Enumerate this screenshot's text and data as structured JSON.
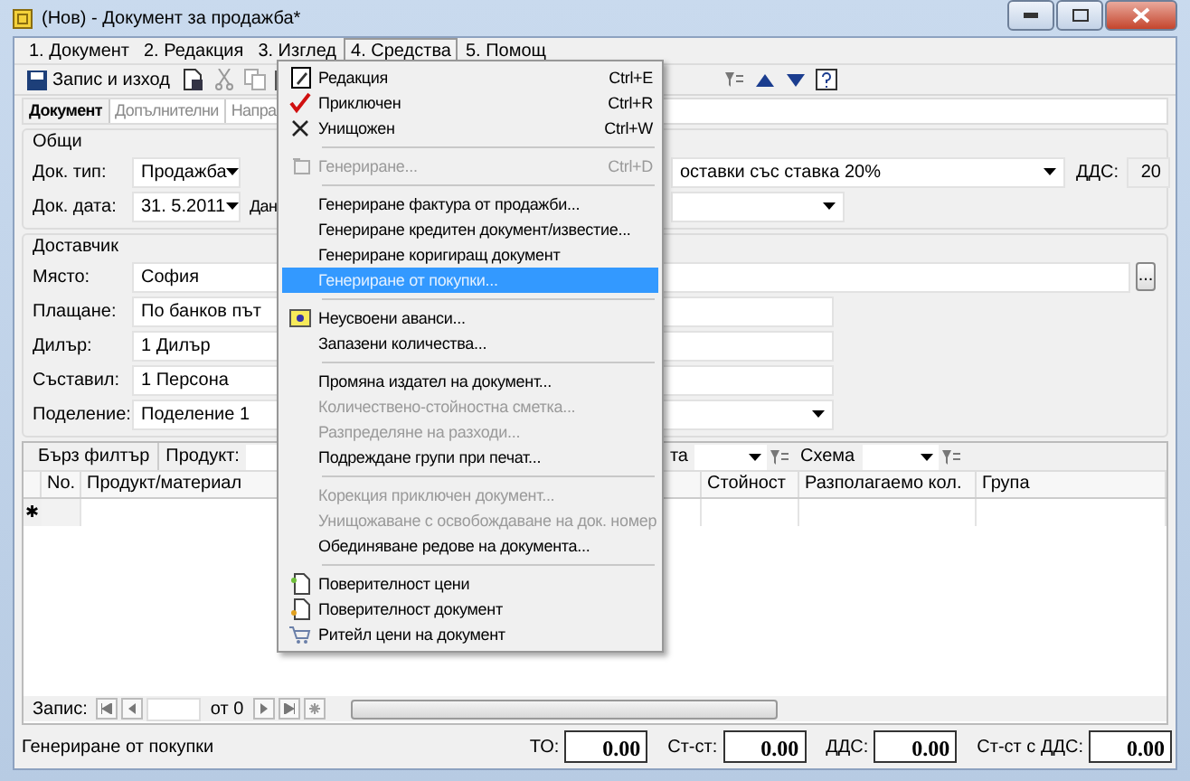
{
  "window": {
    "title": "(Нов) - Документ за продажба*"
  },
  "menu_bar": [
    {
      "label": "1. Документ",
      "selected": false
    },
    {
      "label": "2. Редакция",
      "selected": false
    },
    {
      "label": "3. Изглед",
      "selected": false
    },
    {
      "label": "4. Средства",
      "selected": true
    },
    {
      "label": "5. Помощ",
      "selected": false
    }
  ],
  "toolbar": {
    "save_label": "Запис и изход"
  },
  "tabs": [
    {
      "label": "Документ",
      "selected": true
    },
    {
      "label": "Допълнителни",
      "selected": false
    },
    {
      "label": "Напра",
      "selected": false
    }
  ],
  "general": {
    "title": "Общи",
    "doc_type_label": "Док. тип:",
    "doc_type": "Продажба",
    "doc_date_label": "Док. дата:",
    "doc_date": "31. 5.2011",
    "cut_label": "Дан",
    "vat_scheme": "оставки със ставка 20%",
    "vat_label": "ДДС:",
    "vat": "20"
  },
  "supplier": {
    "title": "Доставчик",
    "fields": [
      {
        "label": "Място:",
        "value": "София",
        "kind": "wide",
        "button": "..."
      },
      {
        "label": "Плащане:",
        "value": "По банков път",
        "kind": "text"
      },
      {
        "label": "Дилър:",
        "value": "1 Дилър",
        "kind": "text"
      },
      {
        "label": "Съставил:",
        "value": "1 Персона",
        "kind": "text"
      },
      {
        "label": "Поделение:",
        "value": "Поделение 1",
        "kind": "combo"
      }
    ]
  },
  "grid": {
    "quick_filter": "Бърз филтър",
    "product_label": "Продукт:",
    "cut_label": "та",
    "scheme_label": "Схема",
    "columns": [
      "No.",
      "Продукт/материал",
      "Стойност",
      "Разполагаемо кол.",
      "Група"
    ],
    "new_row_marker": "✱"
  },
  "navigator": {
    "label": "Запис:",
    "count": "от 0"
  },
  "status_bar": {
    "message": "Генериране от покупки",
    "totals": [
      {
        "label": "ТО:",
        "value": "0.00"
      },
      {
        "label": "Ст-ст:",
        "value": "0.00"
      },
      {
        "label": "ДДС:",
        "value": "0.00"
      },
      {
        "label": "Ст-ст с ДДС:",
        "value": "0.00"
      }
    ]
  },
  "menu": {
    "sections": [
      [
        {
          "label": "Редакция",
          "shortcut": "Ctrl+E",
          "disabled": false,
          "selected": false
        },
        {
          "label": "Приключен",
          "shortcut": "Ctrl+R",
          "disabled": false,
          "selected": false
        },
        {
          "label": "Унищожен",
          "shortcut": "Ctrl+W",
          "disabled": false,
          "selected": false
        }
      ],
      [
        {
          "label": "Генериране...",
          "shortcut": "Ctrl+D",
          "disabled": true,
          "selected": false
        }
      ],
      [
        {
          "label": "Генериране фактура от продажби...",
          "disabled": false,
          "selected": false
        },
        {
          "label": "Генериране кредитен документ/известие...",
          "disabled": false,
          "selected": false
        },
        {
          "label": "Генериране коригиращ документ",
          "disabled": false,
          "selected": false
        },
        {
          "label": "Генериране от покупки...",
          "disabled": false,
          "selected": true
        }
      ],
      [
        {
          "label": "Неусвоени аванси...",
          "disabled": false,
          "selected": false
        },
        {
          "label": "Запазени количества...",
          "disabled": false,
          "selected": false
        }
      ],
      [
        {
          "label": "Промяна издател на документ...",
          "disabled": false,
          "selected": false
        },
        {
          "label": "Количествено-стойностна сметка...",
          "disabled": true,
          "selected": false
        },
        {
          "label": "Разпределяне на разходи...",
          "disabled": true,
          "selected": false
        },
        {
          "label": "Подреждане групи при печат...",
          "disabled": false,
          "selected": false
        }
      ],
      [
        {
          "label": "Корекция приключен документ...",
          "disabled": true,
          "selected": false
        },
        {
          "label": "Унищожаване с освобождаване на док. номер",
          "disabled": true,
          "selected": false
        },
        {
          "label": "Обединяване редове на документа...",
          "disabled": false,
          "selected": false
        }
      ],
      [
        {
          "label": "Поверителност цени",
          "disabled": false,
          "selected": false
        },
        {
          "label": "Поверителност документ",
          "disabled": false,
          "selected": false
        },
        {
          "label": "Ритейл цени на документ",
          "disabled": false,
          "selected": false
        }
      ]
    ]
  }
}
